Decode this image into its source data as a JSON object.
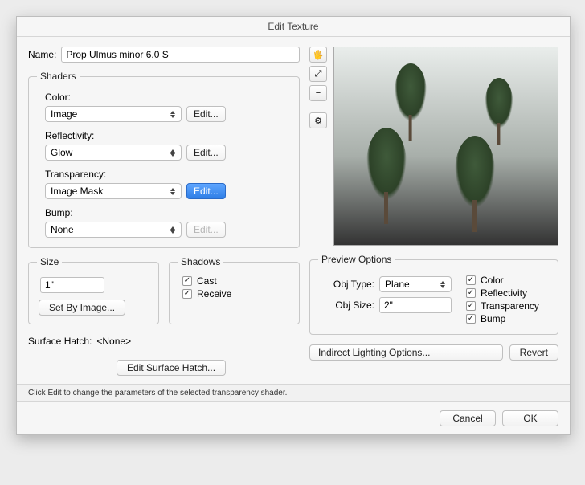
{
  "window": {
    "title": "Edit Texture"
  },
  "name": {
    "label": "Name:",
    "value": "Prop Ulmus minor 6.0 S"
  },
  "shaders": {
    "legend": "Shaders",
    "color": {
      "label": "Color:",
      "value": "Image",
      "edit": "Edit..."
    },
    "reflectivity": {
      "label": "Reflectivity:",
      "value": "Glow",
      "edit": "Edit..."
    },
    "transparency": {
      "label": "Transparency:",
      "value": "Image Mask",
      "edit": "Edit..."
    },
    "bump": {
      "label": "Bump:",
      "value": "None",
      "edit": "Edit..."
    }
  },
  "size": {
    "legend": "Size",
    "value": "1\"",
    "setByImage": "Set By Image..."
  },
  "shadows": {
    "legend": "Shadows",
    "cast": "Cast",
    "receive": "Receive"
  },
  "surfaceHatch": {
    "label": "Surface Hatch:",
    "value": "<None>",
    "edit": "Edit Surface Hatch..."
  },
  "tools": {
    "hand": "✋",
    "zoomFit": "🔍",
    "zoomOut": "🔍",
    "options": "🎚"
  },
  "previewOptions": {
    "legend": "Preview Options",
    "objType": {
      "label": "Obj Type:",
      "value": "Plane"
    },
    "objSize": {
      "label": "Obj Size:",
      "value": "2\""
    },
    "checks": {
      "color": "Color",
      "reflectivity": "Reflectivity",
      "transparency": "Transparency",
      "bump": "Bump"
    }
  },
  "bottom": {
    "indirect": "Indirect Lighting Options...",
    "revert": "Revert"
  },
  "hint": "Click Edit to change the parameters of the selected transparency shader.",
  "footer": {
    "cancel": "Cancel",
    "ok": "OK"
  }
}
